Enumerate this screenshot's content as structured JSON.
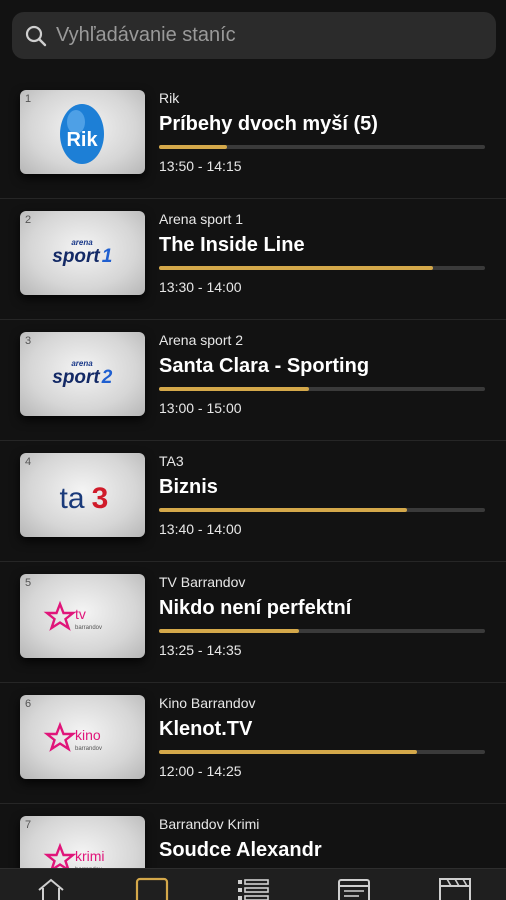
{
  "search": {
    "placeholder": "Vyhľadávanie staníc"
  },
  "channels": [
    {
      "number": "1",
      "channel": "Rik",
      "title": "Príbehy dvoch myší (5)",
      "time": "13:50 - 14:15",
      "progress": 0.21,
      "logo": "rik-logo"
    },
    {
      "number": "2",
      "channel": "Arena sport 1",
      "title": "The Inside Line",
      "time": "13:30 - 14:00",
      "progress": 0.84,
      "logo": "arena-sport-1-logo"
    },
    {
      "number": "3",
      "channel": "Arena sport 2",
      "title": "Santa Clara - Sporting",
      "time": "13:00 - 15:00",
      "progress": 0.46,
      "logo": "arena-sport-2-logo"
    },
    {
      "number": "4",
      "channel": "TA3",
      "title": "Biznis",
      "time": "13:40 - 14:00",
      "progress": 0.76,
      "logo": "ta3-logo"
    },
    {
      "number": "5",
      "channel": "TV Barrandov",
      "title": "Nikdo není perfektní",
      "time": "13:25 - 14:35",
      "progress": 0.43,
      "logo": "tv-barrandov-logo"
    },
    {
      "number": "6",
      "channel": "Kino Barrandov",
      "title": "Klenot.TV",
      "time": "12:00 - 14:25",
      "progress": 0.79,
      "logo": "kino-barrandov-logo"
    },
    {
      "number": "7",
      "channel": "Barrandov Krimi",
      "title": "Soudce Alexandr",
      "time": "",
      "progress": null,
      "logo": "barrandov-krimi-logo"
    }
  ],
  "logos": {
    "rik": "Rik",
    "arena_small": "arena",
    "sport": "sport",
    "sport1": "1",
    "sport2": "2",
    "ta": "ta",
    "three": "3",
    "tv": "tv",
    "kino": "kino",
    "krimi": "krimi",
    "barrandov": "barrandov"
  },
  "nav": [
    {
      "icon": "home-icon"
    },
    {
      "icon": "tv-icon"
    },
    {
      "icon": "list-icon"
    },
    {
      "icon": "guide-icon"
    },
    {
      "icon": "clapperboard-icon"
    }
  ],
  "colors": {
    "accent": "#d4a84a",
    "background": "#121212",
    "search_bg": "#2b2b2b"
  }
}
